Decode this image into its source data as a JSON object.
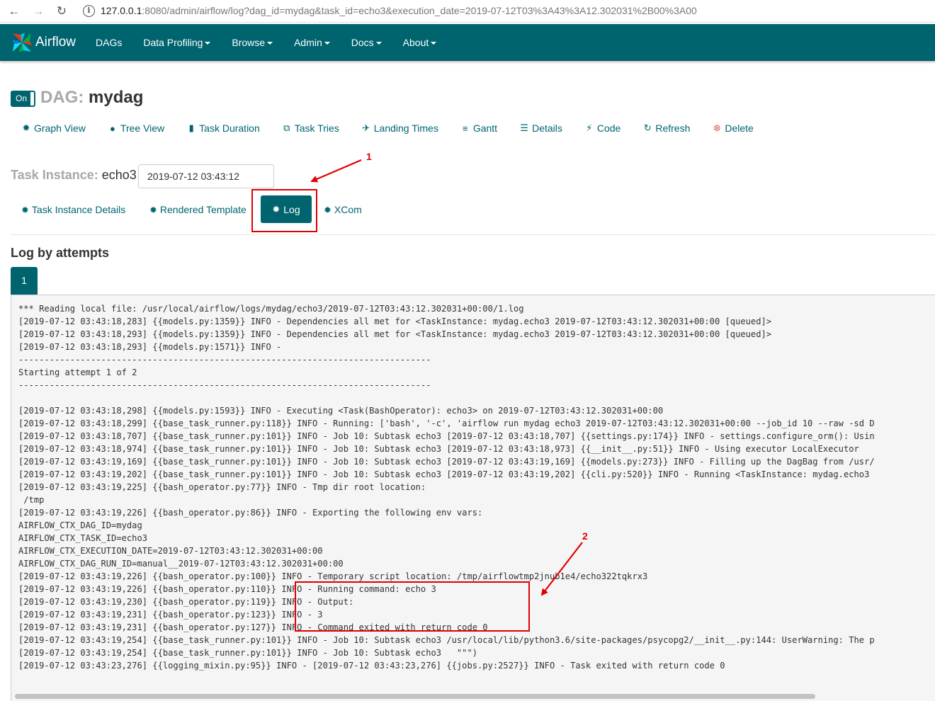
{
  "browser": {
    "url_host": "127.0.0.1",
    "url_rest": ":8080/admin/airflow/log?dag_id=mydag&task_id=echo3&execution_date=2019-07-12T03%3A43%3A12.302031%2B00%3A00"
  },
  "navbar": {
    "brand": "Airflow",
    "items": [
      "DAGs",
      "Data Profiling",
      "Browse",
      "Admin",
      "Docs",
      "About"
    ]
  },
  "dag": {
    "toggle": "On",
    "label": "DAG:",
    "name": "mydag"
  },
  "view_links": [
    {
      "icon": "asterisk",
      "label": "Graph View"
    },
    {
      "icon": "tree",
      "label": "Tree View"
    },
    {
      "icon": "bar-chart",
      "label": "Task Duration"
    },
    {
      "icon": "duplicate",
      "label": "Task Tries"
    },
    {
      "icon": "plane",
      "label": "Landing Times"
    },
    {
      "icon": "align-left",
      "label": "Gantt"
    },
    {
      "icon": "list",
      "label": "Details"
    },
    {
      "icon": "flash",
      "label": "Code"
    },
    {
      "icon": "refresh",
      "label": "Refresh"
    },
    {
      "icon": "remove-circle",
      "label": "Delete"
    }
  ],
  "task_instance": {
    "label": "Task Instance:",
    "name": "echo3",
    "execution_date": "2019-07-12 03:43:12"
  },
  "ti_tabs": {
    "details": "Task Instance Details",
    "rendered": "Rendered Template",
    "log": "Log",
    "xcom": "XCom"
  },
  "log_section": {
    "title": "Log by attempts",
    "attempt": "1"
  },
  "log_lines": [
    "*** Reading local file: /usr/local/airflow/logs/mydag/echo3/2019-07-12T03:43:12.302031+00:00/1.log",
    "[2019-07-12 03:43:18,283] {{models.py:1359}} INFO - Dependencies all met for <TaskInstance: mydag.echo3 2019-07-12T03:43:12.302031+00:00 [queued]>",
    "[2019-07-12 03:43:18,293] {{models.py:1359}} INFO - Dependencies all met for <TaskInstance: mydag.echo3 2019-07-12T03:43:12.302031+00:00 [queued]>",
    "[2019-07-12 03:43:18,293] {{models.py:1571}} INFO -",
    "--------------------------------------------------------------------------------",
    "Starting attempt 1 of 2",
    "--------------------------------------------------------------------------------",
    "",
    "[2019-07-12 03:43:18,298] {{models.py:1593}} INFO - Executing <Task(BashOperator): echo3> on 2019-07-12T03:43:12.302031+00:00",
    "[2019-07-12 03:43:18,299] {{base_task_runner.py:118}} INFO - Running: ['bash', '-c', 'airflow run mydag echo3 2019-07-12T03:43:12.302031+00:00 --job_id 10 --raw -sd D",
    "[2019-07-12 03:43:18,707] {{base_task_runner.py:101}} INFO - Job 10: Subtask echo3 [2019-07-12 03:43:18,707] {{settings.py:174}} INFO - settings.configure_orm(): Usin",
    "[2019-07-12 03:43:18,974] {{base_task_runner.py:101}} INFO - Job 10: Subtask echo3 [2019-07-12 03:43:18,973] {{__init__.py:51}} INFO - Using executor LocalExecutor",
    "[2019-07-12 03:43:19,169] {{base_task_runner.py:101}} INFO - Job 10: Subtask echo3 [2019-07-12 03:43:19,169] {{models.py:273}} INFO - Filling up the DagBag from /usr/",
    "[2019-07-12 03:43:19,202] {{base_task_runner.py:101}} INFO - Job 10: Subtask echo3 [2019-07-12 03:43:19,202] {{cli.py:520}} INFO - Running <TaskInstance: mydag.echo3",
    "[2019-07-12 03:43:19,225] {{bash_operator.py:77}} INFO - Tmp dir root location:",
    " /tmp",
    "[2019-07-12 03:43:19,226] {{bash_operator.py:86}} INFO - Exporting the following env vars:",
    "AIRFLOW_CTX_DAG_ID=mydag",
    "AIRFLOW_CTX_TASK_ID=echo3",
    "AIRFLOW_CTX_EXECUTION_DATE=2019-07-12T03:43:12.302031+00:00",
    "AIRFLOW_CTX_DAG_RUN_ID=manual__2019-07-12T03:43:12.302031+00:00",
    "[2019-07-12 03:43:19,226] {{bash_operator.py:100}} INFO - Temporary script location: /tmp/airflowtmp2jnub1e4/echo322tqkrx3",
    "[2019-07-12 03:43:19,226] {{bash_operator.py:110}} INFO - Running command: echo 3",
    "[2019-07-12 03:43:19,230] {{bash_operator.py:119}} INFO - Output:",
    "[2019-07-12 03:43:19,231] {{bash_operator.py:123}} INFO - 3",
    "[2019-07-12 03:43:19,231] {{bash_operator.py:127}} INFO - Command exited with return code 0",
    "[2019-07-12 03:43:19,254] {{base_task_runner.py:101}} INFO - Job 10: Subtask echo3 /usr/local/lib/python3.6/site-packages/psycopg2/__init__.py:144: UserWarning: The p",
    "[2019-07-12 03:43:19,254] {{base_task_runner.py:101}} INFO - Job 10: Subtask echo3   \"\"\")",
    "[2019-07-12 03:43:23,276] {{logging_mixin.py:95}} INFO - [2019-07-12 03:43:23,276] {{jobs.py:2527}} INFO - Task exited with return code 0"
  ],
  "annotations": {
    "marker_1": "1",
    "marker_2": "2",
    "color": "#e00000"
  }
}
